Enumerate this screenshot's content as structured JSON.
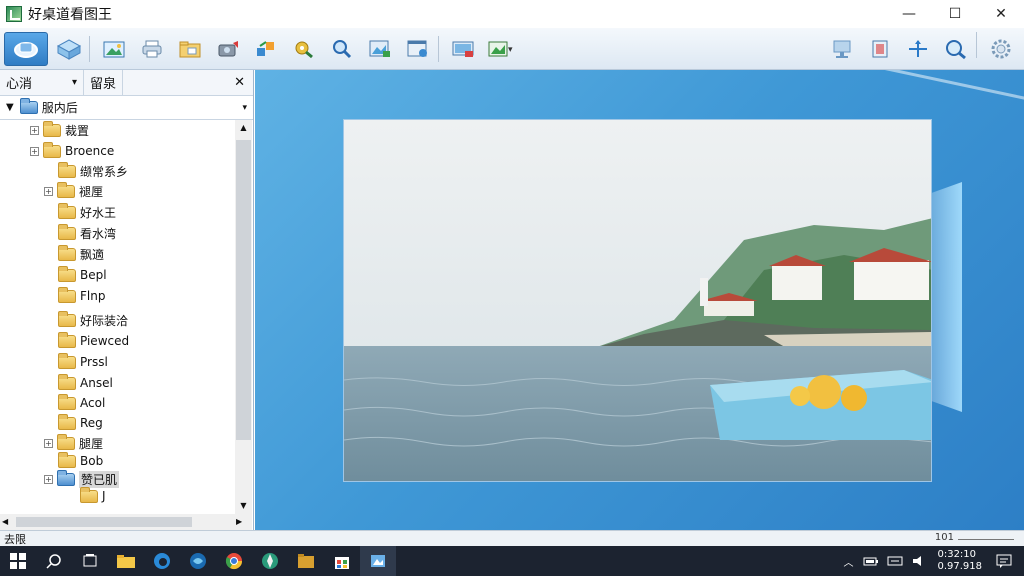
{
  "window": {
    "title": "好桌道看图王",
    "minimize": "—",
    "maximize": "☐",
    "close": "✕"
  },
  "left_panel": {
    "tab1": "心消",
    "tab1_arrow": "▾",
    "tab2": "留泉",
    "close": "✕",
    "combo_value": "服内后",
    "combo_arrow": "▾",
    "tree": [
      {
        "label": "裁置",
        "expander": "+"
      },
      {
        "label": "Broence",
        "expander": "+"
      },
      {
        "label": "缬常系乡",
        "expander": ""
      },
      {
        "label": "褪厘",
        "expander": "+"
      },
      {
        "label": "好水王",
        "expander": ""
      },
      {
        "label": "看水湾",
        "expander": ""
      },
      {
        "label": "飘適",
        "expander": ""
      },
      {
        "label": "Bepl",
        "expander": ""
      },
      {
        "label": "Flnp",
        "expander": ""
      },
      {
        "label": "好际装洽",
        "expander": ""
      },
      {
        "label": "Piewced",
        "expander": ""
      },
      {
        "label": "Prssl",
        "expander": ""
      },
      {
        "label": "Ansel",
        "expander": ""
      },
      {
        "label": "Acol",
        "expander": ""
      },
      {
        "label": "Reg",
        "expander": ""
      },
      {
        "label": "腿厘",
        "expander": "+"
      },
      {
        "label": "Bob",
        "expander": ""
      },
      {
        "label": "赞已肌",
        "expander": "+"
      },
      {
        "label": "J",
        "expander": ""
      }
    ]
  },
  "statusbar": {
    "left": "去限",
    "zoom": "101"
  },
  "taskbar": {
    "clock_time": "0:32:10",
    "clock_date": "0.97.918"
  }
}
